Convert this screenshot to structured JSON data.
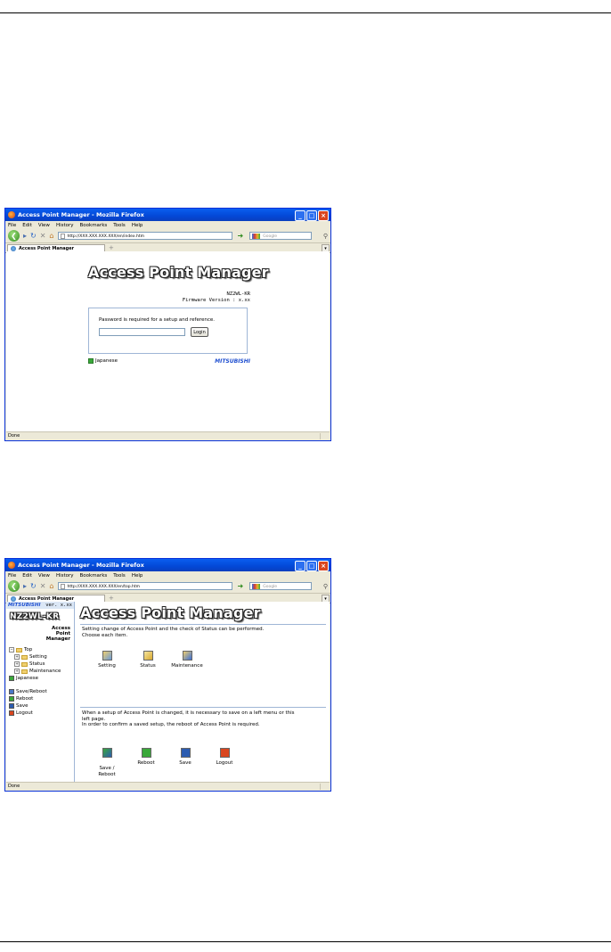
{
  "browser": {
    "window_title": "Access Point Manager - Mozilla Firefox",
    "menu": [
      "File",
      "Edit",
      "View",
      "History",
      "Bookmarks",
      "Tools",
      "Help"
    ],
    "search_placeholder": "Google",
    "tab_label": "Access Point Manager",
    "status": "Done"
  },
  "login_window": {
    "url": "http://XXX.XXX.XXX.XXX/en/index.htm",
    "title": "Access Point Manager",
    "model": "NZ2WL-KR",
    "firmware": "Firmware Version : x.xx",
    "password_message": "Password is required for a setup and reference.",
    "login_button": "Login",
    "japanese_link": "Japanese",
    "brand": "MITSUBISHI"
  },
  "top_window": {
    "url": "http://XXX.XXX.XXX.XXX/en/top.htm",
    "sidebar": {
      "brand": "MITSUBISHI",
      "version": "ver. x.xx",
      "logo": "NZ2WL-KR",
      "subtitle_line1": "Access Point",
      "subtitle_line2": "Manager",
      "tree": [
        "Top",
        "Setting",
        "Status",
        "Maintenance",
        "Japanese"
      ],
      "actions": [
        "Save/Reboot",
        "Reboot",
        "Save",
        "Logout"
      ]
    },
    "main": {
      "title": "Access Point Manager",
      "intro_line1": "Setting change of Access Point and the check of Status can be performed.",
      "intro_line2": "Choose each item.",
      "items": [
        "Setting",
        "Status",
        "Maintenance"
      ],
      "note_line1": "When a setup of Access Point is changed, it is necessary to save on a left menu or this",
      "note_line2": "left page.",
      "note_line3": "In order to confirm a saved setup, the reboot of Access Point is required.",
      "actions": [
        "Save /\nReboot",
        "Reboot",
        "Save",
        "Logout"
      ]
    }
  }
}
